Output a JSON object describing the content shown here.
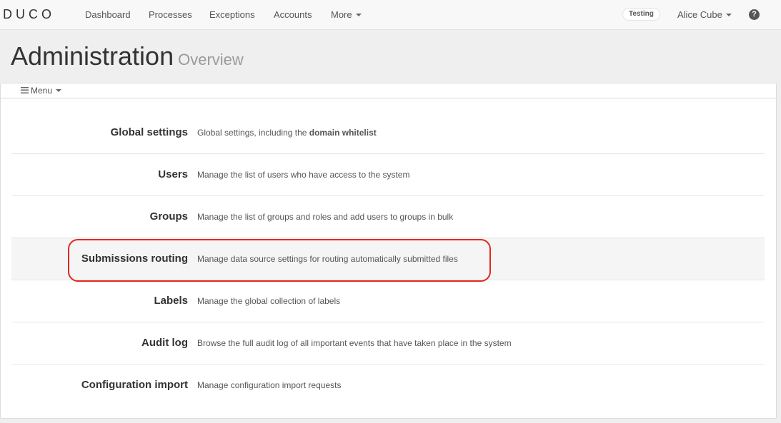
{
  "navbar": {
    "logo": "DUCO",
    "links": [
      "Dashboard",
      "Processes",
      "Exceptions",
      "Accounts"
    ],
    "more_label": "More",
    "environment_badge": "Testing",
    "user_name": "Alice Cube",
    "help_glyph": "?"
  },
  "header": {
    "title": "Administration",
    "subtitle": "Overview"
  },
  "menu": {
    "label": "Menu"
  },
  "items": [
    {
      "title": "Global settings",
      "description_prefix": "Global settings, including the ",
      "description_bold": "domain whitelist"
    },
    {
      "title": "Users",
      "description": "Manage the list of users who have access to the system"
    },
    {
      "title": "Groups",
      "description": "Manage the list of groups and roles and add users to groups in bulk"
    },
    {
      "title": "Submissions routing",
      "description": "Manage data source settings for routing automatically submitted files"
    },
    {
      "title": "Labels",
      "description": "Manage the global collection of labels"
    },
    {
      "title": "Audit log",
      "description": "Browse the full audit log of all important events that have taken place in the system"
    },
    {
      "title": "Configuration import",
      "description": "Manage configuration import requests"
    }
  ],
  "colors": {
    "highlight_ring": "#e0291d",
    "highlight_row_bg": "#f5f5f5"
  },
  "icons": [
    "hamburger-icon",
    "help-icon",
    "caret-down-icon"
  ]
}
